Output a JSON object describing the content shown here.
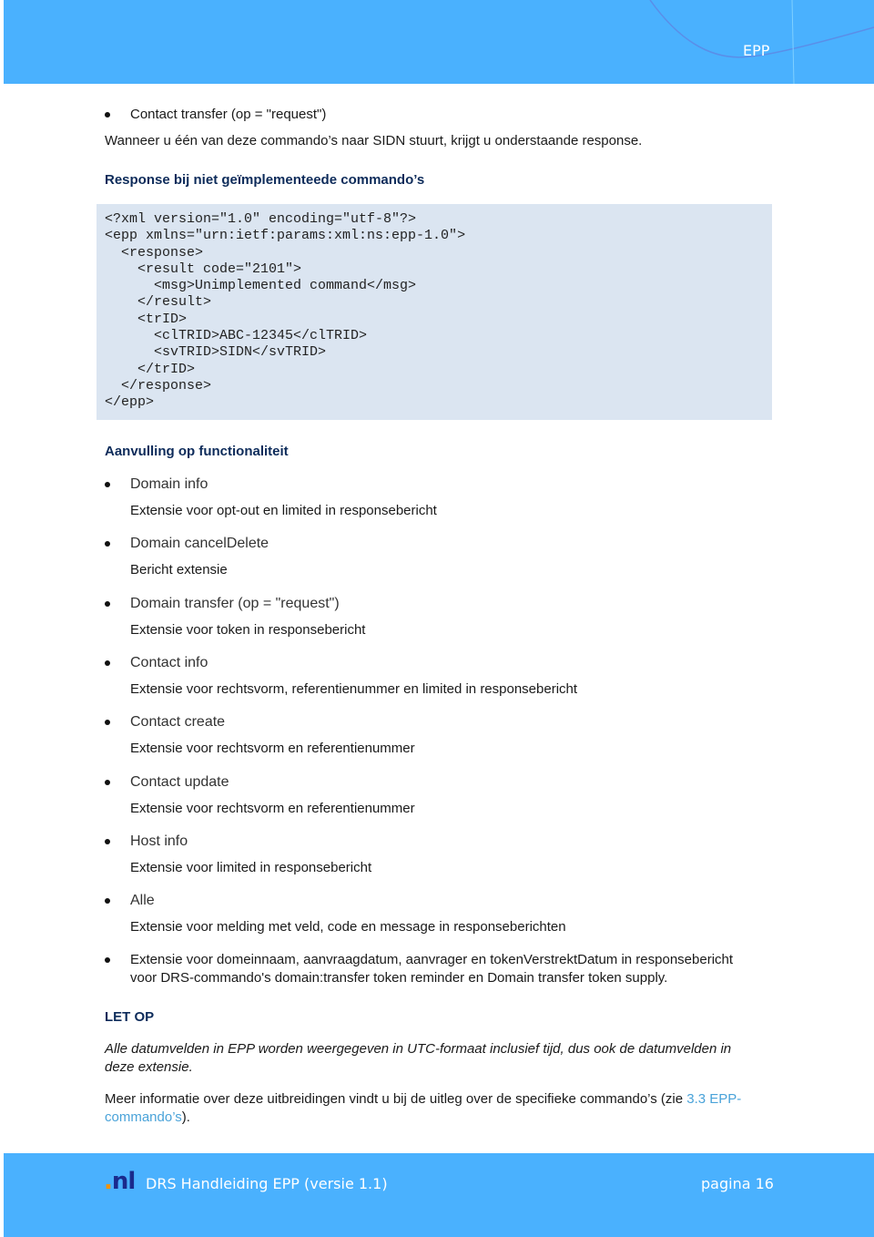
{
  "header": {
    "title": "EPP"
  },
  "intro": {
    "bullet": "Contact transfer (op = \"request\")",
    "text": "Wanneer u één van deze commando’s naar SIDN stuurt, krijgt u onderstaande response."
  },
  "response_heading": "Response bij niet geïmplementeede commando’s",
  "code_lines": [
    "<?xml version=\"1.0\" encoding=\"utf-8\"?>",
    "<epp xmlns=\"urn:ietf:params:xml:ns:epp-1.0\">",
    "  <response>",
    "    <result code=\"2101\">",
    "      <msg>Unimplemented command</msg>",
    "    </result>",
    "    <trID>",
    "      <clTRID>ABC-12345</clTRID>",
    "      <svTRID>SIDN</svTRID>",
    "    </trID>",
    "  </response>",
    "</epp>"
  ],
  "aanvulling_heading": "Aanvulling op functionaliteit",
  "items": [
    {
      "title": "Domain info",
      "desc": "Extensie voor opt-out en limited in responsebericht"
    },
    {
      "title": "Domain cancelDelete",
      "desc": "Bericht extensie"
    },
    {
      "title": "Domain transfer (op = \"request\")",
      "desc": "Extensie voor token in responsebericht"
    },
    {
      "title": "Contact info",
      "desc": "Extensie voor rechtsvorm, referentienummer en limited in responsebericht"
    },
    {
      "title": "Contact create",
      "desc": "Extensie voor rechtsvorm en referentienummer"
    },
    {
      "title": "Contact update",
      "desc": "Extensie voor rechtsvorm en referentienummer"
    },
    {
      "title": "Host info",
      "desc": "Extensie voor limited in responsebericht"
    },
    {
      "title": "Alle",
      "desc": "Extensie voor melding met veld, code en message in responseberichten"
    }
  ],
  "last_bullet": {
    "line1": "Extensie voor domeinnaam, aanvraagdatum, aanvrager en tokenVerstrektDatum in responsebericht",
    "line2": "voor DRS-commando's domain:transfer token reminder en Domain transfer token supply."
  },
  "let_op": {
    "heading": "LET OP",
    "line1": "Alle datumvelden in EPP worden weergegeven in UTC-formaat inclusief tijd, dus ook de datumvelden in",
    "line2": "deze extensie."
  },
  "meer": {
    "line1": "Meer informatie over deze uitbreidingen vindt u bij de uitleg over de specifieke commando’s (zie ",
    "link1": "3.3 EPP-",
    "link2": "commando’s",
    "end": ")."
  },
  "footer": {
    "logo": ".nl",
    "title": "DRS Handleiding EPP  (versie 1.1)",
    "page": "pagina 16"
  },
  "colors": {
    "header": "#4ab1fe",
    "heading": "#0d2b5a",
    "code_bg": "#dbe5f1",
    "link": "#4aa3d9"
  }
}
